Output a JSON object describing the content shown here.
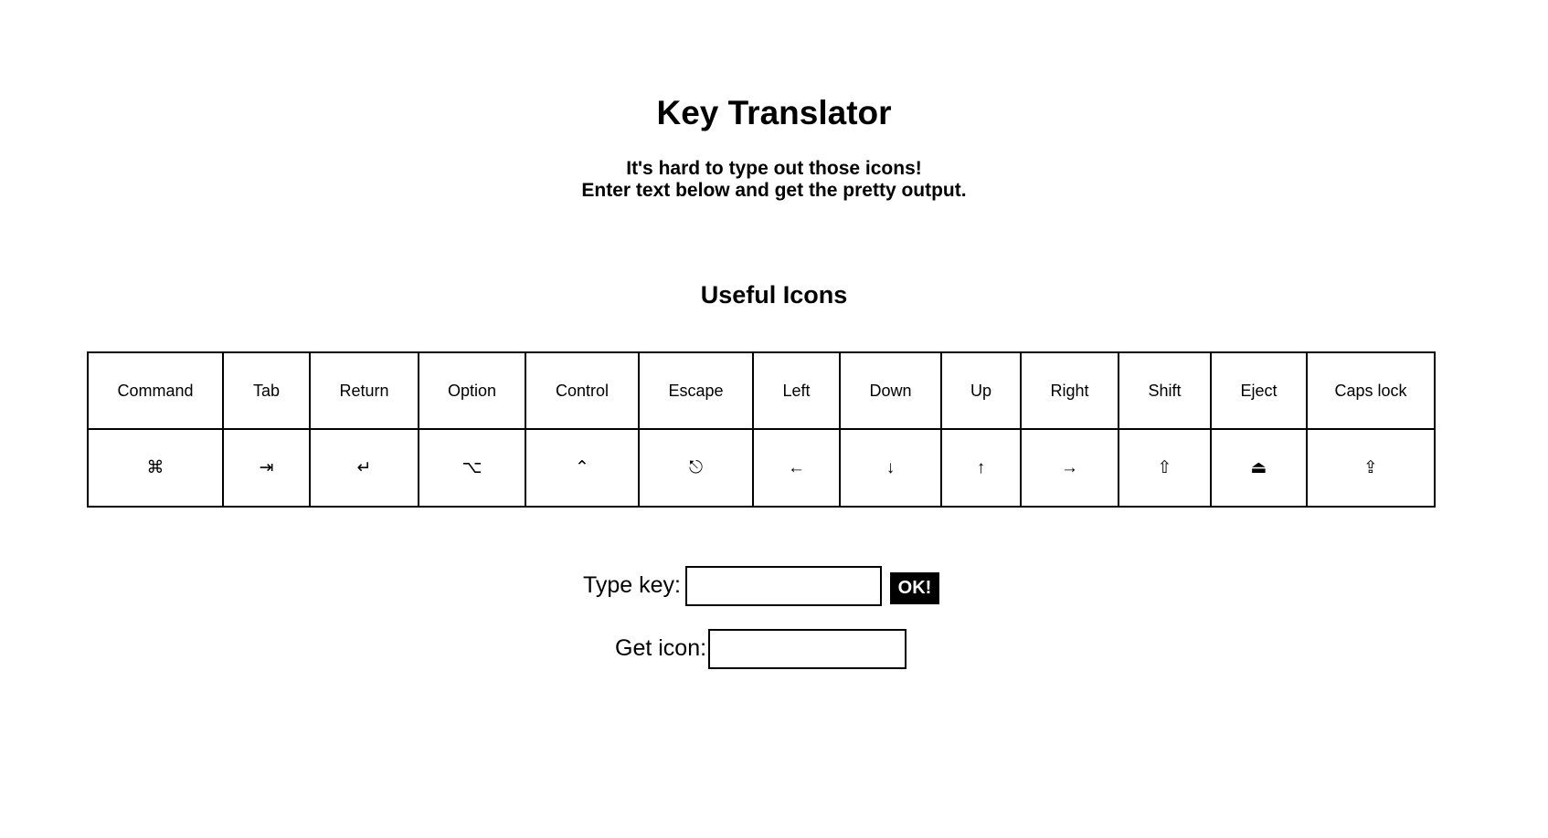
{
  "header": {
    "title": "Key Translator",
    "subtitle_line1": "It's hard to type out those icons!",
    "subtitle_line2": "Enter text below and get the pretty output."
  },
  "icons_section": {
    "title": "Useful Icons",
    "keys": [
      {
        "name": "Command",
        "glyph": "⌘",
        "icon": "command-icon"
      },
      {
        "name": "Tab",
        "glyph": "⇥",
        "icon": "tab-icon"
      },
      {
        "name": "Return",
        "glyph": "↵",
        "icon": "return-icon"
      },
      {
        "name": "Option",
        "glyph": "⌥",
        "icon": "option-icon"
      },
      {
        "name": "Control",
        "glyph": "⌃",
        "icon": "control-icon"
      },
      {
        "name": "Escape",
        "glyph": "⎋",
        "icon": "escape-icon"
      },
      {
        "name": "Left",
        "glyph": "←",
        "icon": "left-arrow-icon"
      },
      {
        "name": "Down",
        "glyph": "↓",
        "icon": "down-arrow-icon"
      },
      {
        "name": "Up",
        "glyph": "↑",
        "icon": "up-arrow-icon"
      },
      {
        "name": "Right",
        "glyph": "→",
        "icon": "right-arrow-icon"
      },
      {
        "name": "Shift",
        "glyph": "⇧",
        "icon": "shift-icon"
      },
      {
        "name": "Eject",
        "glyph": "⏏",
        "icon": "eject-icon"
      },
      {
        "name": "Caps lock",
        "glyph": "⇪",
        "icon": "caps-lock-icon"
      }
    ]
  },
  "form": {
    "type_key_label": "Type key:",
    "type_key_value": "",
    "ok_label": "OK!",
    "get_icon_label": "Get icon:",
    "get_icon_value": ""
  }
}
